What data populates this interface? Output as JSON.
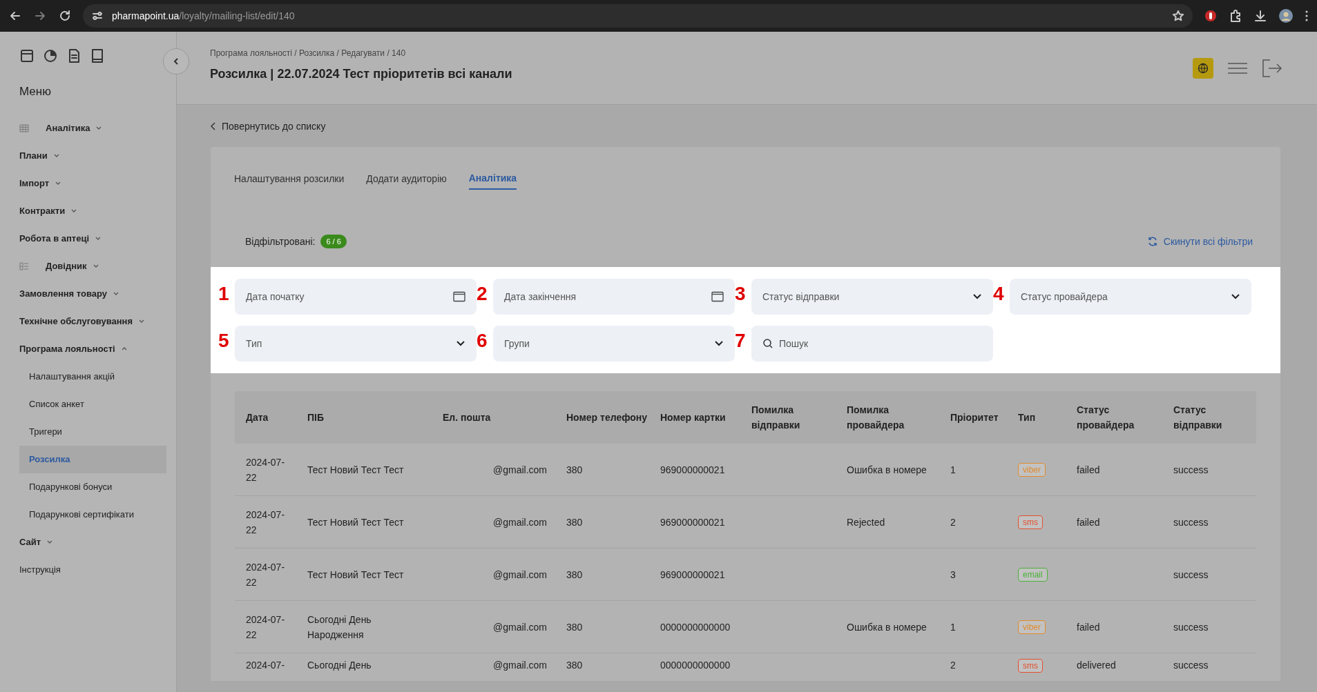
{
  "browser": {
    "url_host": "pharmapoint.ua",
    "url_path": "/loyalty/mailing-list/edit/140"
  },
  "sidebar": {
    "title": "Меню",
    "items": [
      {
        "label": "Аналітика",
        "kind": "gridgroup",
        "expanded": false
      },
      {
        "label": "Плани",
        "kind": "group",
        "expanded": false
      },
      {
        "label": "Імпорт",
        "kind": "group",
        "expanded": false
      },
      {
        "label": "Контракти",
        "kind": "group",
        "expanded": false
      },
      {
        "label": "Робота в аптеці",
        "kind": "group",
        "expanded": false
      },
      {
        "label": "Довідник",
        "kind": "listgroup",
        "expanded": false
      },
      {
        "label": "Замовлення товару",
        "kind": "group",
        "expanded": false
      },
      {
        "label": "Технічне обслуговування",
        "kind": "group",
        "expanded": false
      },
      {
        "label": "Програма лояльності",
        "kind": "group",
        "expanded": true,
        "children": [
          {
            "label": "Налаштування акцій",
            "selected": false
          },
          {
            "label": "Список анкет",
            "selected": false
          },
          {
            "label": "Тригери",
            "selected": false
          },
          {
            "label": "Розсилка",
            "selected": true
          },
          {
            "label": "Подарункові бонуси",
            "selected": false
          },
          {
            "label": "Подарункові сертифікати",
            "selected": false
          }
        ]
      },
      {
        "label": "Сайт",
        "kind": "group",
        "expanded": false
      },
      {
        "label": "Інструкція",
        "kind": "link"
      }
    ]
  },
  "header": {
    "breadcrumb": "Програма лояльності / Розсилка / Редагувати / 140",
    "title": "Розсилка | 22.07.2024 Тест пріоритетів всі канали"
  },
  "back_link": "Повернутись до списку",
  "tabs": [
    {
      "label": "Налаштування розсилки",
      "selected": false
    },
    {
      "label": "Додати аудиторію",
      "selected": false
    },
    {
      "label": "Аналітика",
      "selected": true
    }
  ],
  "filtered": {
    "label": "Відфільтровані:",
    "count": "6 / 6"
  },
  "reset_filters": "Скинути всі фільтри",
  "filters": [
    {
      "marker": "1",
      "kind": "date",
      "placeholder": "Дата початку"
    },
    {
      "marker": "2",
      "kind": "date",
      "placeholder": "Дата закінчення"
    },
    {
      "marker": "3",
      "kind": "select",
      "placeholder": "Статус відправки"
    },
    {
      "marker": "4",
      "kind": "select",
      "placeholder": "Статус провайдера"
    },
    {
      "marker": "5",
      "kind": "select",
      "placeholder": "Тип"
    },
    {
      "marker": "6",
      "kind": "select",
      "placeholder": "Групи"
    },
    {
      "marker": "7",
      "kind": "search",
      "placeholder": "Пошук"
    }
  ],
  "table": {
    "columns": [
      "Дата",
      "ПІБ",
      "Ел. пошта",
      "Номер телефону",
      "Номер картки",
      "Помилка відправки",
      "Помилка провайдера",
      "Пріоритет",
      "Тип",
      "Статус провайдера",
      "Статус відправки"
    ],
    "rows": [
      {
        "date": "2024-07-22",
        "name": "Тест Новий Тест Тест",
        "email": "@gmail.com",
        "phone": "380",
        "card": "969000000021",
        "send_error": "",
        "provider_error": "Ошибка в номере",
        "priority": "1",
        "type": {
          "label": "viber",
          "color": "#e08a2e"
        },
        "provider_status": "failed",
        "send_status": "success"
      },
      {
        "date": "2024-07-22",
        "name": "Тест Новий Тест Тест",
        "email": "@gmail.com",
        "phone": "380",
        "card": "969000000021",
        "send_error": "",
        "provider_error": "Rejected",
        "priority": "2",
        "type": {
          "label": "sms",
          "color": "#e0502e"
        },
        "provider_status": "failed",
        "send_status": "success"
      },
      {
        "date": "2024-07-22",
        "name": "Тест Новий Тест Тест",
        "email": "@gmail.com",
        "phone": "380",
        "card": "969000000021",
        "send_error": "",
        "provider_error": "",
        "priority": "3",
        "type": {
          "label": "email",
          "color": "#4caf3a"
        },
        "provider_status": "",
        "send_status": "success"
      },
      {
        "date": "2024-07-22",
        "name": "Сьогодні День Народження",
        "email": "@gmail.com",
        "phone": "380",
        "card": "0000000000000",
        "send_error": "",
        "provider_error": "Ошибка в номере",
        "priority": "1",
        "type": {
          "label": "viber",
          "color": "#e08a2e"
        },
        "provider_status": "failed",
        "send_status": "success"
      },
      {
        "date": "2024-07-",
        "name": "Сьогодні День",
        "email": "@gmail.com",
        "phone": "380",
        "card": "0000000000000",
        "send_error": "",
        "provider_error": "",
        "priority": "2",
        "type": {
          "label": "sms",
          "color": "#e0502e"
        },
        "provider_status": "delivered",
        "send_status": "success"
      }
    ]
  }
}
